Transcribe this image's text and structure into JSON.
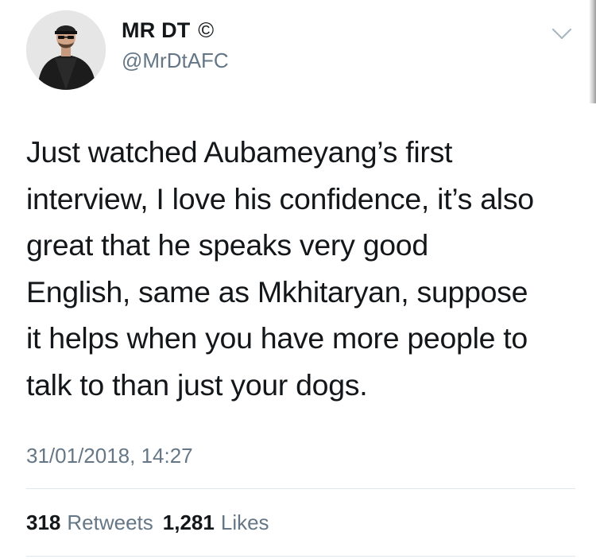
{
  "author": {
    "display_name": "MR DT",
    "name_mark": "©",
    "handle": "@MrDtAFC",
    "avatar_icon": "profile-photo"
  },
  "tweet": {
    "text": "Just watched Aubameyang’s first\ninterview, I love his confidence, it’s also\ngreat that he speaks very good\nEnglish, same as Mkhitaryan, suppose\nit helps when you have more people to\ntalk to than just your dogs.",
    "timestamp": "31/01/2018, 14:27"
  },
  "stats": {
    "retweets_count": "318",
    "retweets_label": "Retweets",
    "likes_count": "1,281",
    "likes_label": "Likes"
  },
  "colors": {
    "text_primary": "#14171a",
    "text_secondary": "#657786",
    "divider": "#e1e8ed",
    "chevron": "#aab8c2"
  }
}
